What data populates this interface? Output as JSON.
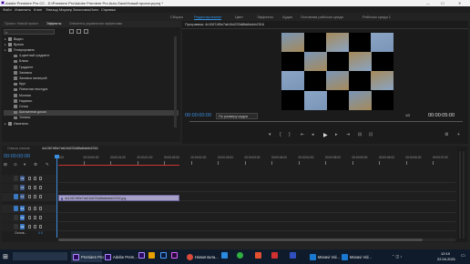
{
  "titlebar": {
    "title": "Adobe Premiere Pro CC - D:\\Premiere Pro\\Adobe Premiere Pro Auto-Save\\Новый проект.prproj *",
    "minimize": "—",
    "maximize": "☐",
    "close": "✕"
  },
  "menu": [
    "Файл",
    "Изменить",
    "Клип",
    "Эпизод",
    "Маркер",
    "Заголовок",
    "Окно",
    "Справка"
  ],
  "workspaces": [
    "Сборка",
    "Редактирование",
    "Цвет",
    "Эффекты",
    "Аудио",
    "Основная рабочая среда",
    "Рабочая среда 1"
  ],
  "workspace_active": 1,
  "left_panel": {
    "tabs": [
      "Проект: Новый проект",
      "Эффекты",
      "Элементы управления эффектами"
    ],
    "active_tab": 1,
    "search_placeholder": "",
    "items": [
      {
        "label": "Видео",
        "level": 0,
        "type": "folder"
      },
      {
        "label": "Время",
        "level": 0,
        "type": "folder"
      },
      {
        "label": "Генерировать",
        "level": 0,
        "type": "folder"
      },
      {
        "label": "4-цветный градиент",
        "level": 1,
        "type": "effect"
      },
      {
        "label": "Блики",
        "level": 1,
        "type": "effect"
      },
      {
        "label": "Градиент",
        "level": 1,
        "type": "effect"
      },
      {
        "label": "Заливка",
        "level": 1,
        "type": "effect"
      },
      {
        "label": "Заливка палитрой",
        "level": 1,
        "type": "effect"
      },
      {
        "label": "Круг",
        "level": 1,
        "type": "effect"
      },
      {
        "label": "Ячеистая текстура",
        "level": 1,
        "type": "effect"
      },
      {
        "label": "Молния",
        "level": 1,
        "type": "effect"
      },
      {
        "label": "Надпись",
        "level": 1,
        "type": "effect"
      },
      {
        "label": "Сетка",
        "level": 1,
        "type": "effect"
      },
      {
        "label": "Шахматная доска",
        "level": 1,
        "type": "effect",
        "selected": true
      },
      {
        "label": "Эллипс",
        "level": 1,
        "type": "effect"
      },
      {
        "label": "Изменить",
        "level": 0,
        "type": "folder"
      }
    ]
  },
  "program": {
    "title": "Программа: 4c1067df0e7ab16d233d8fa8dcbb2316",
    "timecode": "00:00:00:00",
    "fit": "По размеру кадра",
    "quality": "1/2",
    "duration": "00:00:05:00"
  },
  "sequence": {
    "tabs": [
      "Список клипов",
      "4c1067df0e7ab16d233d8fa8dcbb2316"
    ],
    "timecode": "00:00:00:00",
    "ruler": [
      "00:00",
      "00:00:00:30",
      "00:00:01:00",
      "00:00:01:30",
      "00:00:02:00",
      "00:00:02:30",
      "00:00:03:00",
      "00:00:03:30",
      "00:00:04:00",
      "00:00:04:30",
      "00:00:05:00",
      "00:00:05:30",
      "00:00:06:00",
      "00:00:06:30",
      "00:00:07:00"
    ],
    "tracks": [
      "V3",
      "V2",
      "V1",
      "A1",
      "A2",
      "A3"
    ],
    "master": "Основ...",
    "master_value": "0.0",
    "clip": "4c1067df0e7ab16d233d8fa8dcbb2316.jpg"
  },
  "taskbar": {
    "items": [
      "Premiere Pro",
      "Adobe Prem...",
      "",
      "",
      "Новая вкла...",
      "",
      "",
      "",
      "Movavi Vid...",
      "Movavi Vid..."
    ],
    "time": "12:10",
    "date": "22.04.2021"
  },
  "colors": {
    "accent": "#2f8fe0",
    "track_video": "#3d5a8a",
    "track_audio": "#3a78c2",
    "taskbar": "#0f1b2b"
  }
}
